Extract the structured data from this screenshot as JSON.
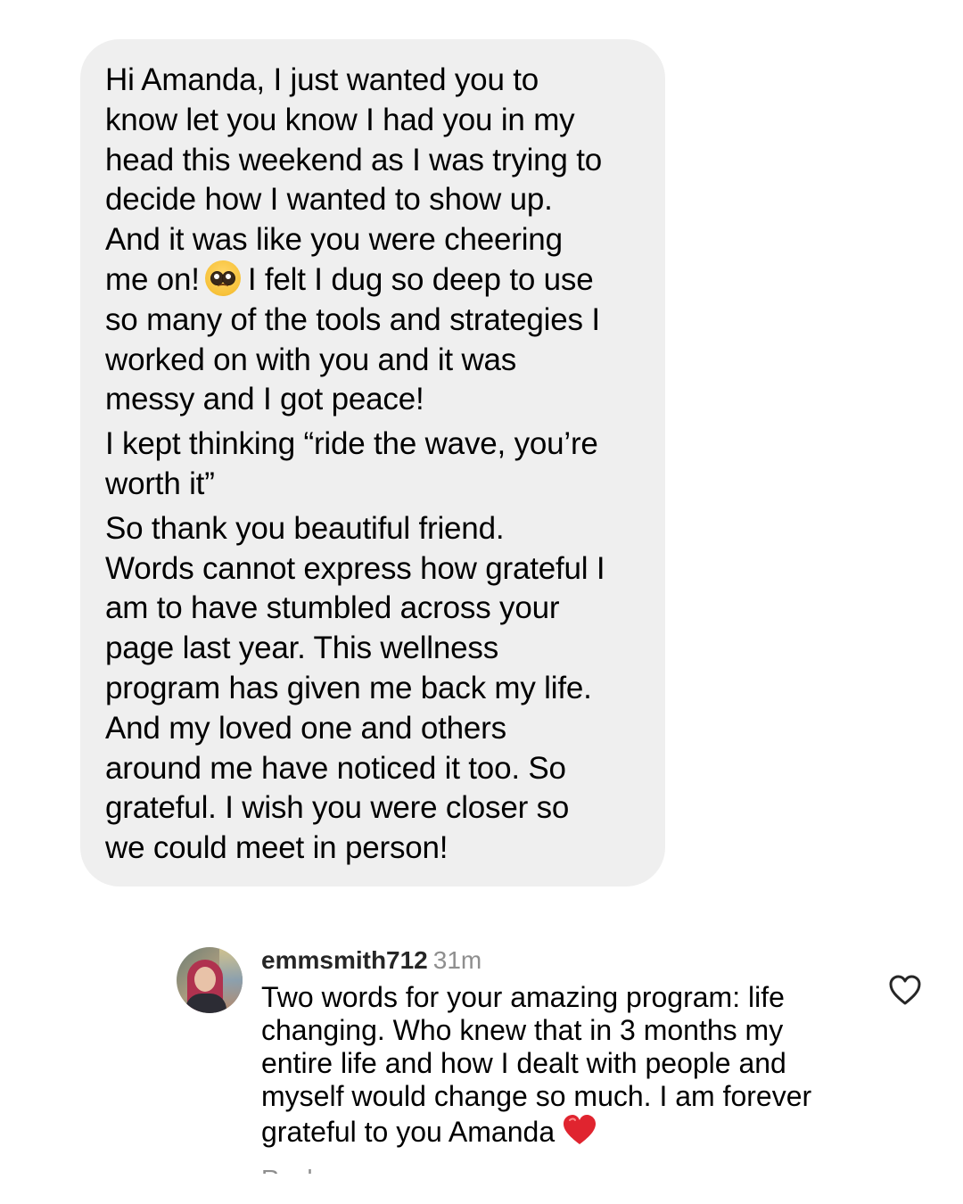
{
  "message": {
    "paragraphs": [
      {
        "lines": [
          "Hi Amanda, I just wanted you to",
          "know let you know I had you in my",
          "head this weekend as I was trying to",
          "decide how I wanted to show up.",
          "And it was like you were cheering"
        ],
        "emoji_line_before": "me on!",
        "emoji_line_after": "I felt I dug so deep to use",
        "emoji": "pleading-face-emoji",
        "lines_after": [
          "so many of the tools and strategies I",
          "worked on with you and it was",
          "messy and I got peace!"
        ]
      },
      {
        "lines": [
          "I kept thinking “ride the wave, you’re",
          "worth it”"
        ]
      },
      {
        "lines": [
          "So thank you beautiful friend.",
          "Words cannot express how grateful I",
          "am to have stumbled across your",
          "page last year.  This wellness",
          "program has given me back my life.",
          "And my loved one and others",
          "around me have noticed it too.  So",
          "grateful.  I wish you were closer so",
          "we could meet in person!"
        ]
      }
    ]
  },
  "comment": {
    "username": "emmsmith712",
    "time": "31m",
    "lines": [
      "Two words for your amazing program: life",
      "changing. Who knew that in 3 months my",
      "entire life and how I dealt with people and",
      "myself would change so much. I am forever"
    ],
    "last_line": "grateful to you Amanda",
    "emoji": "red-heart-emoji",
    "like_icon": "heart-outline-icon",
    "reply_label": "Reply"
  },
  "colors": {
    "bubble_bg": "#efefef",
    "username": "#262626",
    "muted": "#8e8e8e",
    "heart_red": "#e0242f"
  }
}
